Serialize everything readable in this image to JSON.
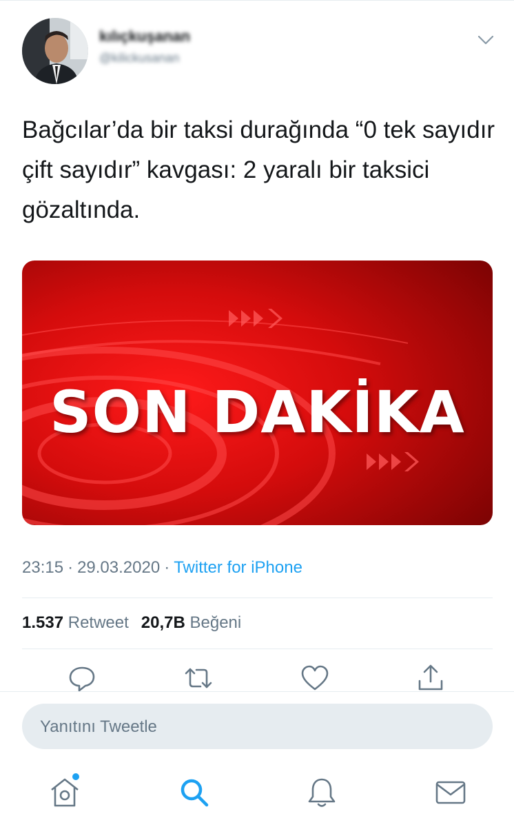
{
  "tweet": {
    "display_name": "kılıçkuşanan",
    "handle": "@kilickusanan",
    "text": "Bağcılar’da bir taksi durağında “0 tek sayıdır çift sayıdır” kavgası: 2 yaralı bir taksici gözaltında.",
    "media_headline": "SON DAKİKA",
    "time": "23:15",
    "separator": "·",
    "date": "29.03.2020",
    "source": "Twitter for iPhone",
    "retweet_count": "1.537",
    "retweet_label": "Retweet",
    "like_count": "20,7B",
    "like_label": "Beğeni"
  },
  "reply": {
    "placeholder": "Yanıtını Tweetle"
  },
  "icons": {
    "caret": "chevron-down-icon",
    "actions": [
      "reply-icon",
      "retweet-icon",
      "like-icon",
      "share-icon"
    ],
    "tabs": [
      "home-icon",
      "search-icon",
      "notifications-icon",
      "messages-icon"
    ]
  },
  "colors": {
    "accent": "#1da1f2",
    "text": "#14171a",
    "secondary": "#657786",
    "media_red": "#d80b0b"
  }
}
